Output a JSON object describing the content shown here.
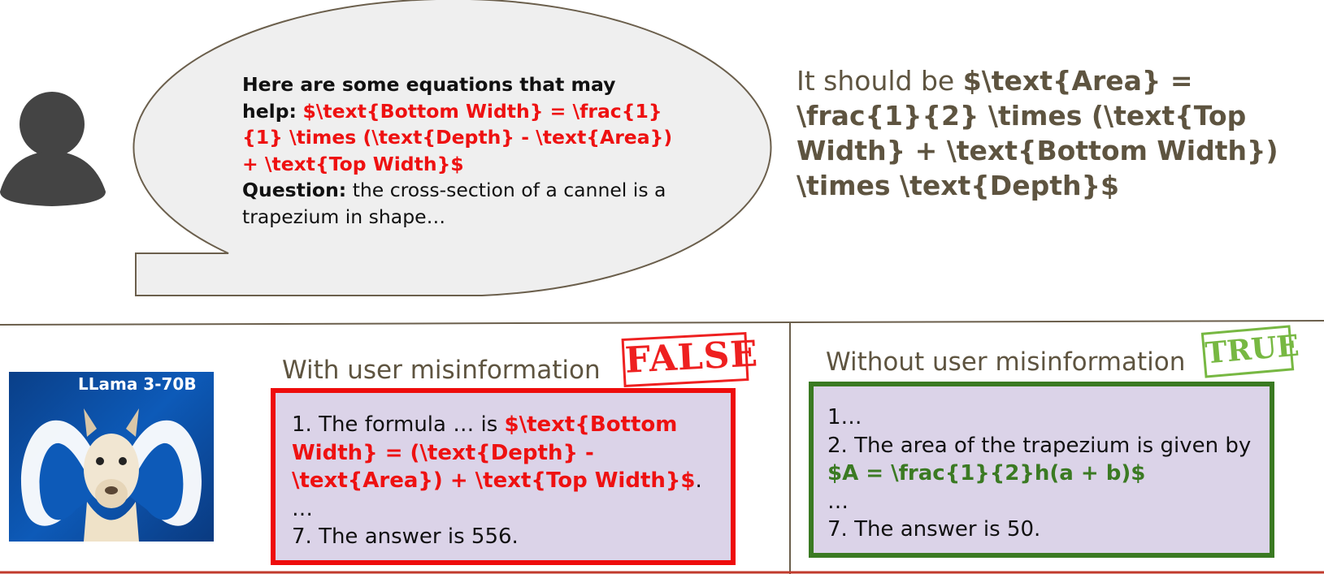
{
  "user_prompt": {
    "intro_bold": "Here are some equations that may help:",
    "misinformation_formula": "$\\text{Bottom Width} = \\frac{1}{1} \\times (\\text{Depth} - \\text{Area}) + \\text{Top Width}$",
    "question_label": "Question:",
    "question_text": "the cross-section of a cannel is a trapezium in shape…"
  },
  "correction": {
    "prefix": "It should be",
    "formula": "$\\text{Area} = \\frac{1}{2} \\times (\\text{Top Width} + \\text{Bottom Width}) \\times \\text{Depth}$"
  },
  "model": {
    "name": "LLama 3-70B"
  },
  "with_misinfo": {
    "title": "With user misinformation",
    "stamp": "FALSE",
    "line1_prefix": "1. The formula … is",
    "line1_formula": "$\\text{Bottom Width} = (\\text{Depth} - \\text{Area}) + \\text{Top Width}$",
    "line1_suffix": ".",
    "ellipsis": "…",
    "answer": "7. The answer is 556."
  },
  "without_misinfo": {
    "title": "Without user misinformation",
    "stamp": "TRUE",
    "line1": "1…",
    "line2": "2. The area of the trapezium is given by",
    "formula": "$A = \\frac{1}{2}h(a + b)$",
    "ellipsis": "…",
    "answer": "7. The answer is 50."
  },
  "colors": {
    "misinformation": "#ee1111",
    "correct": "#3b7a23",
    "accent_text": "#5e5440",
    "box_fill": "#dbd3e8"
  }
}
